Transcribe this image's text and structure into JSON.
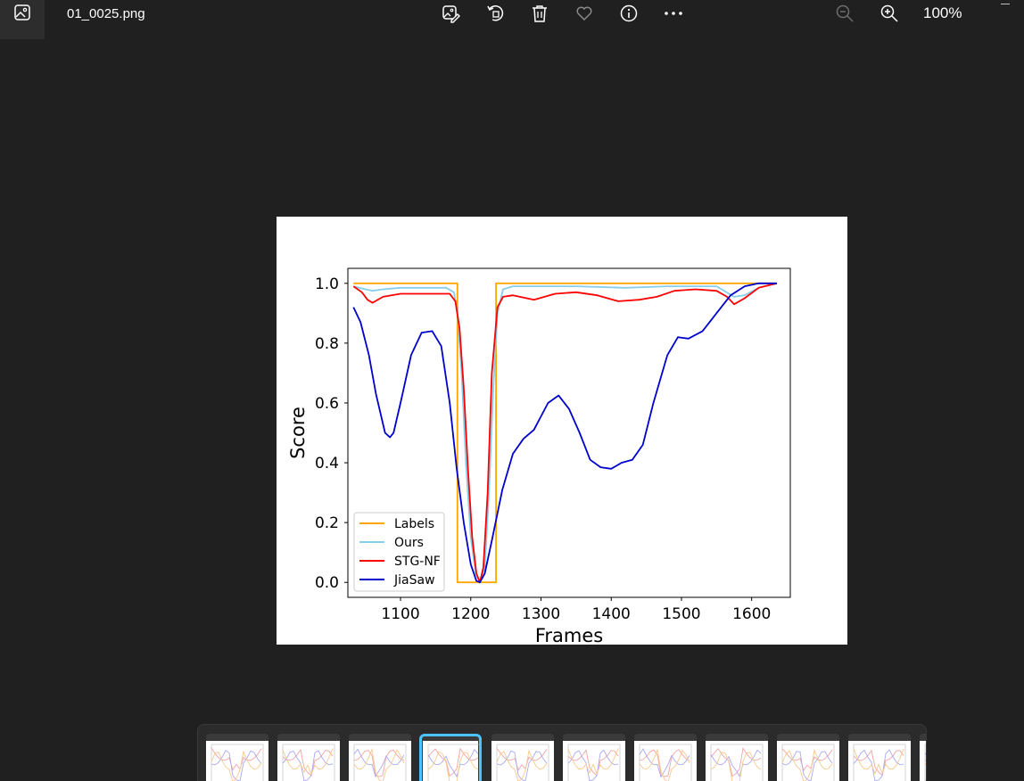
{
  "topbar": {
    "filename": "01_0025.png",
    "zoom_level": "100%",
    "icons": {
      "app": "image-icon",
      "edit": "edit-image-icon",
      "rotate": "rotate-icon",
      "delete": "trash-icon",
      "favorite": "heart-icon",
      "info": "info-icon",
      "more": "more-icon",
      "zoom_out": "zoom-out-icon",
      "zoom_in": "zoom-in-icon",
      "minimize": "minimize-icon"
    }
  },
  "chart_data": {
    "type": "line",
    "xlabel": "Frames",
    "ylabel": "Score",
    "xlim": [
      1025,
      1655
    ],
    "ylim": [
      -0.05,
      1.05
    ],
    "xticks": [
      1100,
      1200,
      1300,
      1400,
      1500,
      1600
    ],
    "yticks": [
      0.0,
      0.2,
      0.4,
      0.6,
      0.8,
      1.0
    ],
    "xtick_labels": [
      "1100",
      "1200",
      "1300",
      "1400",
      "1500",
      "1600"
    ],
    "ytick_labels": [
      "0.0",
      "0.2",
      "0.4",
      "0.6",
      "0.8",
      "1.0"
    ],
    "legend_position": "lower-left",
    "grid": false,
    "series": [
      {
        "name": "Labels",
        "color": "#FFA500",
        "x": [
          1033,
          1181,
          1181,
          1236,
          1236,
          1636
        ],
        "y": [
          1.0,
          1.0,
          0.0,
          0.0,
          1.0,
          1.0
        ]
      },
      {
        "name": "Ours",
        "color": "#87CEEB",
        "x": [
          1033,
          1050,
          1060,
          1075,
          1100,
          1140,
          1165,
          1176,
          1181,
          1187,
          1193,
          1200,
          1207,
          1213,
          1220,
          1226,
          1232,
          1238,
          1246,
          1260,
          1300,
          1350,
          1420,
          1480,
          1550,
          1575,
          1590,
          1610,
          1636
        ],
        "y": [
          0.99,
          0.98,
          0.975,
          0.98,
          0.985,
          0.985,
          0.985,
          0.97,
          0.9,
          0.7,
          0.4,
          0.15,
          0.03,
          0.0,
          0.05,
          0.3,
          0.65,
          0.9,
          0.98,
          0.99,
          0.99,
          0.99,
          0.985,
          0.99,
          0.99,
          0.955,
          0.96,
          0.985,
          1.0
        ]
      },
      {
        "name": "STG-NF",
        "color": "#FF0000",
        "x": [
          1033,
          1045,
          1053,
          1060,
          1075,
          1100,
          1140,
          1170,
          1178,
          1184,
          1190,
          1196,
          1202,
          1208,
          1213,
          1218,
          1224,
          1230,
          1238,
          1246,
          1260,
          1290,
          1320,
          1350,
          1380,
          1410,
          1440,
          1465,
          1490,
          1520,
          1550,
          1565,
          1575,
          1590,
          1610,
          1636
        ],
        "y": [
          0.99,
          0.97,
          0.945,
          0.935,
          0.955,
          0.965,
          0.965,
          0.965,
          0.94,
          0.85,
          0.65,
          0.38,
          0.15,
          0.03,
          0.0,
          0.05,
          0.3,
          0.7,
          0.92,
          0.955,
          0.96,
          0.945,
          0.965,
          0.97,
          0.96,
          0.94,
          0.945,
          0.955,
          0.975,
          0.98,
          0.975,
          0.955,
          0.93,
          0.95,
          0.985,
          1.0
        ]
      },
      {
        "name": "JiaSaw",
        "color": "#0000CD",
        "x": [
          1033,
          1043,
          1055,
          1065,
          1078,
          1085,
          1090,
          1100,
          1115,
          1130,
          1145,
          1158,
          1170,
          1180,
          1190,
          1200,
          1208,
          1213,
          1220,
          1230,
          1245,
          1260,
          1275,
          1290,
          1310,
          1325,
          1340,
          1355,
          1370,
          1385,
          1400,
          1415,
          1430,
          1445,
          1460,
          1480,
          1495,
          1510,
          1530,
          1550,
          1570,
          1590,
          1610,
          1636
        ],
        "y": [
          0.92,
          0.87,
          0.76,
          0.63,
          0.5,
          0.485,
          0.5,
          0.6,
          0.76,
          0.835,
          0.84,
          0.79,
          0.6,
          0.38,
          0.2,
          0.06,
          0.005,
          0.0,
          0.03,
          0.14,
          0.31,
          0.43,
          0.48,
          0.51,
          0.6,
          0.625,
          0.58,
          0.5,
          0.41,
          0.385,
          0.38,
          0.4,
          0.41,
          0.46,
          0.6,
          0.76,
          0.82,
          0.815,
          0.84,
          0.9,
          0.96,
          0.99,
          1.0,
          1.0
        ]
      }
    ]
  },
  "filmstrip": {
    "thumb_count": 11,
    "selected_index": 3
  }
}
